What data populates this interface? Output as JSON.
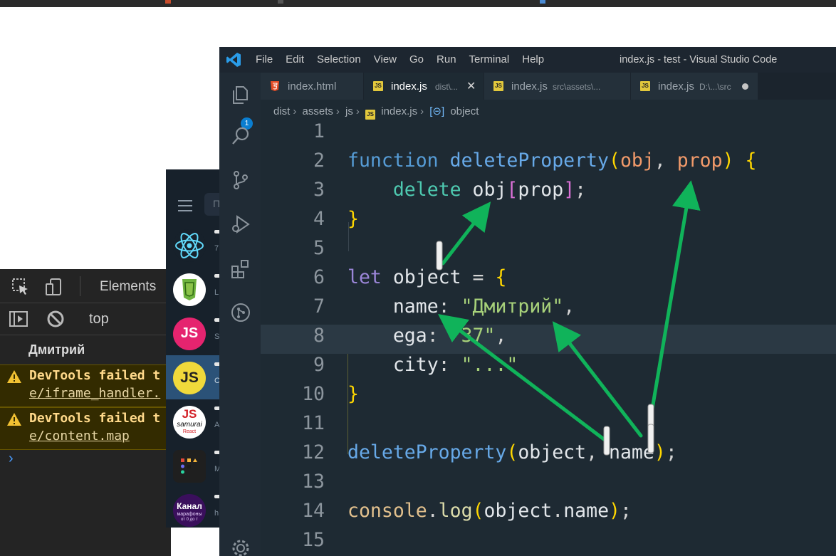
{
  "devtools": {
    "tab_elements": "Elements",
    "context": "top",
    "log_text": "Дмитрий",
    "warnings": [
      {
        "line1": "DevTools failed t",
        "line2": "e/iframe_handler."
      },
      {
        "line1": "DevTools failed t",
        "line2": "e/content.map"
      }
    ],
    "prompt": "›"
  },
  "telegram": {
    "search_placeholder": "П",
    "chats": [
      {
        "sub": "7",
        "icon": "react-logo-icon"
      },
      {
        "sub": "L",
        "icon": "css-badge-icon"
      },
      {
        "sub": "S",
        "icon": "js-pink-icon"
      },
      {
        "sub": "C",
        "icon": "js-yellow-icon"
      },
      {
        "sub": "A",
        "icon": "samurai-js-icon",
        "avatar_text": "JS",
        "avatar_sub": "samurai",
        "avatar_sub2": "React"
      },
      {
        "sub": "M",
        "icon": "dots-grid-icon"
      },
      {
        "sub": "h",
        "icon": "kanal-icon",
        "avatar_text": "Канал",
        "avatar_sub": "марафоны",
        "avatar_sub2": "от 0 до т"
      }
    ]
  },
  "vscode": {
    "menu": [
      "File",
      "Edit",
      "Selection",
      "View",
      "Go",
      "Run",
      "Terminal",
      "Help"
    ],
    "window_title": "index.js - test - Visual Studio Code",
    "explorer_badge": "1",
    "tabs": [
      {
        "label": "index.html",
        "desc": ""
      },
      {
        "label": "index.js",
        "desc": "dist\\...",
        "close": "✕"
      },
      {
        "label": "index.js",
        "desc": "src\\assets\\..."
      },
      {
        "label": "index.js",
        "desc": "D:\\...\\src"
      }
    ],
    "breadcrumb": [
      "dist",
      "assets",
      "js",
      "index.js",
      "object"
    ],
    "breadcrumb_sep": "›",
    "line_numbers": [
      "1",
      "2",
      "3",
      "4",
      "5",
      "6",
      "7",
      "8",
      "9",
      "10",
      "11",
      "12",
      "13",
      "14",
      "15"
    ],
    "code": {
      "l2": {
        "kw": "function",
        "fn": "deleteProperty",
        "p1": "(",
        "a1": "obj",
        "c": ",",
        "a2": "prop",
        "p2": ")",
        "b": "{"
      },
      "l3": {
        "kw": "delete",
        "v": "obj",
        "o": "[",
        "k": "prop",
        "cl": "]",
        "s": ";"
      },
      "l4": {
        "b": "}"
      },
      "l6": {
        "kw": "let",
        "v": "object",
        "eq": "=",
        "b": "{"
      },
      "l7": {
        "k": "name",
        "c": ":",
        "s": "\"Дмитрий\"",
        "comma": ","
      },
      "l8": {
        "k": "ega",
        "c": ":",
        "s": "\"37\"",
        "comma": ","
      },
      "l9": {
        "k": "city",
        "c": ":",
        "s": "\"...\""
      },
      "l10": {
        "b": "}"
      },
      "l12": {
        "fn": "deleteProperty",
        "p1": "(",
        "a1": "object",
        "c": ",",
        "a2": "name",
        "p2": ")",
        "s": ";"
      },
      "l14": {
        "v": "console",
        "d": ".",
        "fn": "log",
        "p1": "(",
        "a": "object",
        "d2": ".",
        "k": "name",
        "p2": ")",
        "s": ";"
      }
    }
  },
  "colors": {
    "arrow": "#10b35a",
    "accent": "#0a7ed1"
  }
}
